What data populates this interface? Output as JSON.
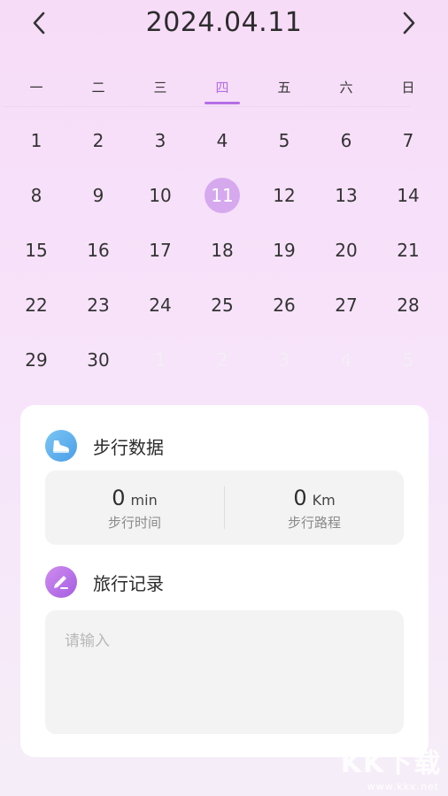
{
  "header": {
    "date_title": "2024.04.11",
    "prev_icon": "chevron-left-icon",
    "next_icon": "chevron-right-icon"
  },
  "calendar": {
    "weekdays": [
      "一",
      "二",
      "三",
      "四",
      "五",
      "六",
      "日"
    ],
    "active_weekday_index": 3,
    "days": [
      "1",
      "2",
      "3",
      "4",
      "5",
      "6",
      "7",
      "8",
      "9",
      "10",
      "11",
      "12",
      "13",
      "14",
      "15",
      "16",
      "17",
      "18",
      "19",
      "20",
      "21",
      "22",
      "23",
      "24",
      "25",
      "26",
      "27",
      "28",
      "29",
      "30",
      "1",
      "2",
      "3",
      "4",
      "5"
    ],
    "selected_day_index": 10,
    "first_muted_index": 30,
    "accent_color": "#b46ee6",
    "selected_color": "#d6a9ef"
  },
  "walking": {
    "title": "步行数据",
    "icon": "shoe-icon",
    "time_value": "0",
    "time_unit": "min",
    "time_label": "步行时间",
    "distance_value": "0",
    "distance_unit": "Km",
    "distance_label": "步行路程"
  },
  "travel": {
    "title": "旅行记录",
    "icon": "pen-icon",
    "input_placeholder": "请输入",
    "input_value": ""
  },
  "watermark": {
    "text": "KK下载",
    "url": "www.kkx.net"
  }
}
